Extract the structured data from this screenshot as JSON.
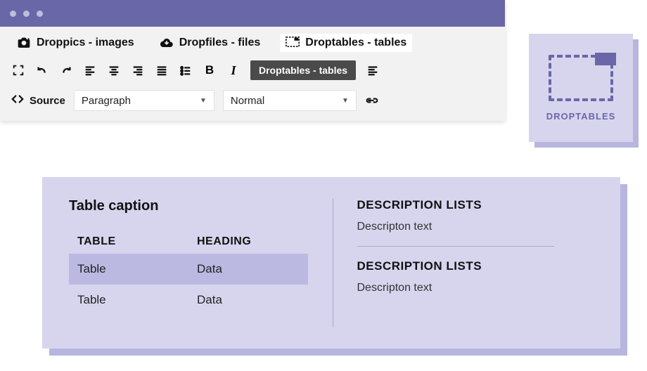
{
  "window": {
    "tabs": [
      {
        "label": "Droppics - images"
      },
      {
        "label": "Dropfiles - files"
      },
      {
        "label": "Droptables - tables",
        "active": true
      }
    ]
  },
  "toolbar": {
    "pill_label": "Droptables - tables"
  },
  "row2": {
    "source_label": "Source",
    "select1": "Paragraph",
    "select2": "Normal"
  },
  "sidecard": {
    "label": "DROPTABLES"
  },
  "panel": {
    "caption": "Table caption",
    "table": {
      "head": [
        "TABLE",
        "HEADING"
      ],
      "rows": [
        [
          "Table",
          "Data"
        ],
        [
          "Table",
          "Data"
        ]
      ]
    },
    "lists": [
      {
        "title": "DESCRIPTION LISTS",
        "text": "Descripton text"
      },
      {
        "title": "DESCRIPTION LISTS",
        "text": "Descripton text"
      }
    ]
  }
}
